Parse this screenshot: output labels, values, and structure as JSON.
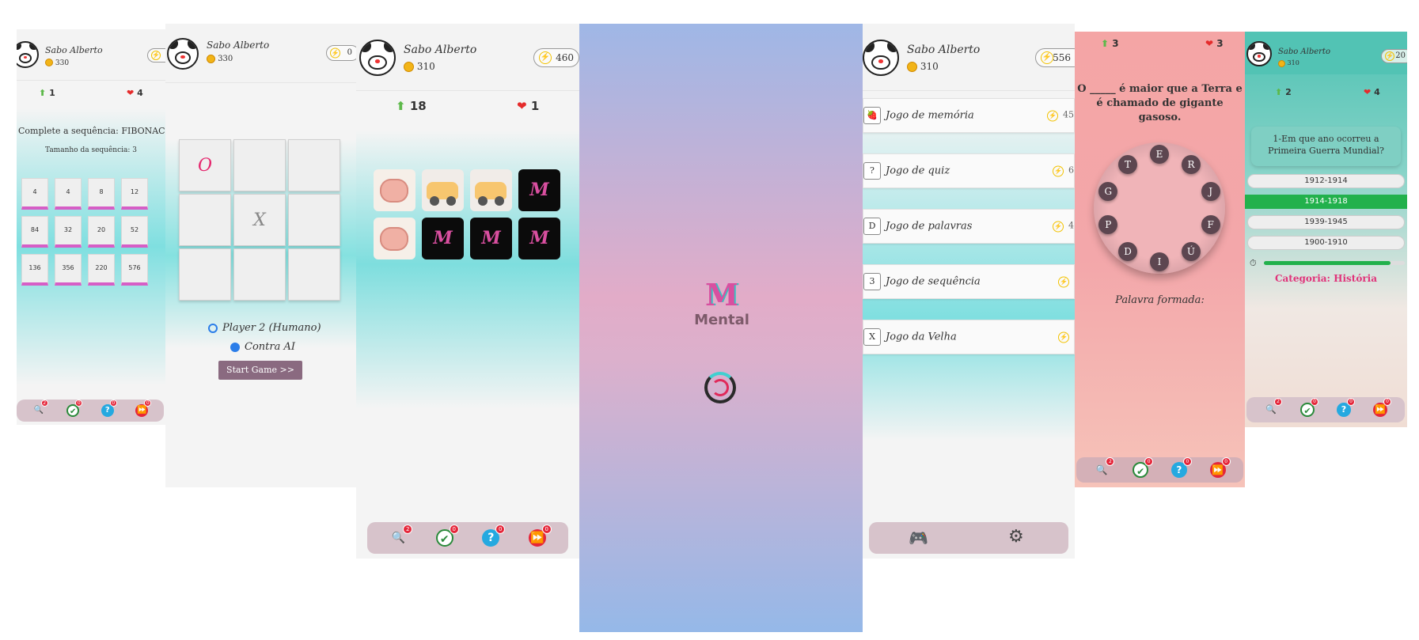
{
  "user": {
    "name": "Sabo Alberto"
  },
  "s1": {
    "coins": "330",
    "level": "1",
    "lives": "4",
    "title": "Complete a sequência: FIBONACCI",
    "subtitle": "Tamanho da sequência: 3",
    "cells": [
      "4",
      "4",
      "8",
      "12",
      "84",
      "32",
      "20",
      "52",
      "136",
      "356",
      "220",
      "576"
    ],
    "badges": [
      "2",
      "0",
      "0",
      "0"
    ]
  },
  "s2": {
    "coins": "330",
    "energy": "0",
    "board": [
      "O",
      "",
      "",
      "",
      "X",
      "",
      "",
      "",
      ""
    ],
    "opt1": "Player 2 (Humano)",
    "opt2": "Contra AI",
    "start": "Start Game >>"
  },
  "s3": {
    "coins": "310",
    "energy": "460",
    "level": "18",
    "lives": "1",
    "badges": [
      "2",
      "0",
      "0",
      "0"
    ],
    "back_logo": "M"
  },
  "s4": {
    "logo": "Mental"
  },
  "s5": {
    "coins": "310",
    "energy": "556",
    "items": [
      {
        "label": "Jogo de memória",
        "icon": "🍓",
        "cost": "45"
      },
      {
        "label": "Jogo de quiz",
        "icon": "?",
        "cost": "6"
      },
      {
        "label": "Jogo de palavras",
        "icon": "D",
        "cost": "4"
      },
      {
        "label": "Jogo de sequência",
        "icon": "3",
        "cost": ""
      },
      {
        "label": "Jogo da Velha",
        "icon": "X",
        "cost": ""
      }
    ]
  },
  "s6": {
    "level": "3",
    "lives": "3",
    "question": "O _____ é maior que a Terra e é chamado de gigante gasoso.",
    "letters": [
      "E",
      "R",
      "J",
      "F",
      "Ú",
      "I",
      "D",
      "P",
      "G",
      "T"
    ],
    "formed": "Palavra formada:",
    "badges": [
      "2",
      "0",
      "0",
      "0"
    ]
  },
  "s7": {
    "coins": "310",
    "energy": "20",
    "level": "2",
    "lives": "4",
    "question": "1-Em que ano ocorreu a Primeira Guerra Mundial?",
    "options": [
      "1912-1914",
      "1914-1918",
      "1939-1945",
      "1900-1910"
    ],
    "category": "Categoria: História",
    "progress": 0.9,
    "badges": [
      "2",
      "0",
      "0",
      "0"
    ]
  }
}
